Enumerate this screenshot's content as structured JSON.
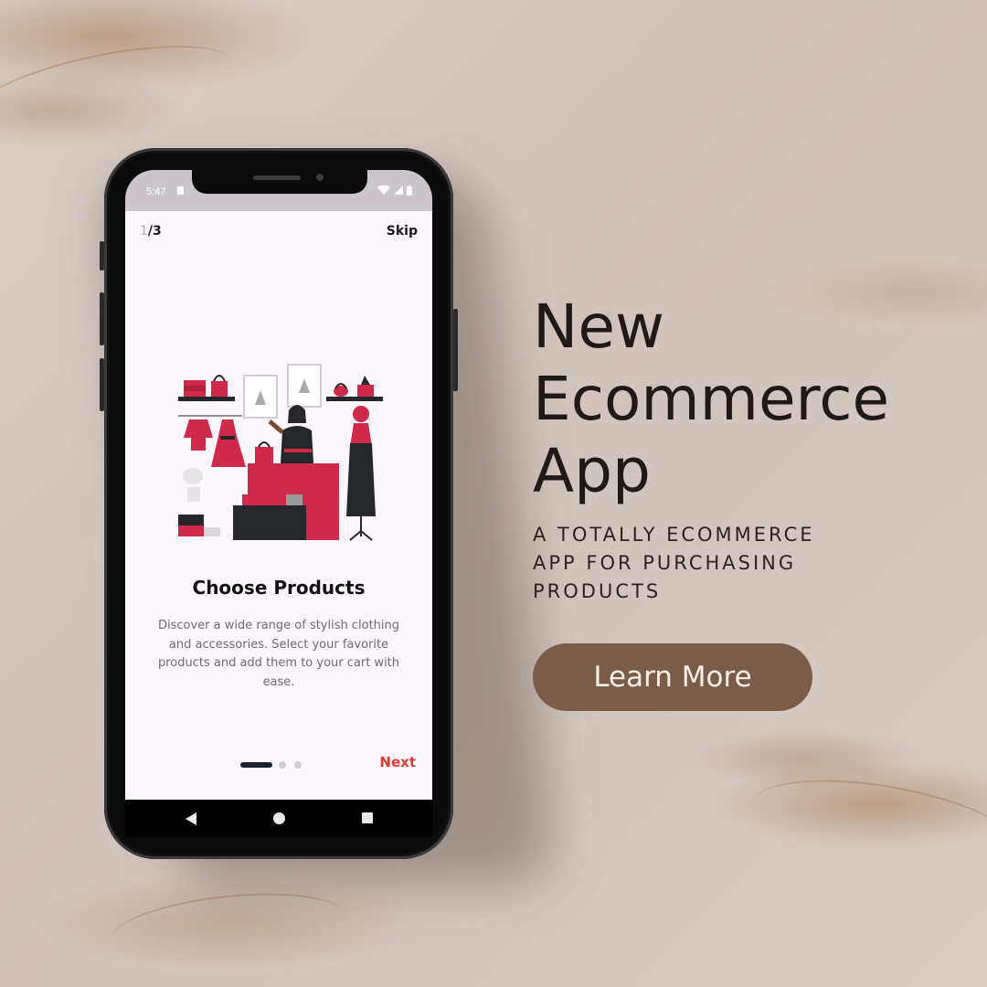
{
  "phone": {
    "status_bar": {
      "time": "5:47",
      "icons_right": [
        "wifi-icon",
        "signal-icon",
        "battery-icon"
      ]
    },
    "onboarding": {
      "page_current": "1",
      "page_total": "/3",
      "skip_label": "Skip",
      "title": "Choose Products",
      "description": "Discover a wide range of stylish clothing and accessories. Select your favorite products and add them to your cart with ease.",
      "next_label": "Next",
      "progress": {
        "current_step": 1,
        "total_steps": 3
      }
    },
    "nav_bar": {
      "icons": [
        "back-icon",
        "home-icon",
        "recents-icon"
      ]
    }
  },
  "promo": {
    "headline_lines": [
      "New",
      "Ecommerce",
      "App"
    ],
    "subheadline_lines": [
      "A TOTALLY ECOMMERCE",
      "APP FOR PURCHASING",
      "PRODUCTS"
    ],
    "cta_label": "Learn More"
  },
  "colors": {
    "accent_red": "#e23a33",
    "illustration_red": "#cf2a49",
    "dark_navy": "#1b2437",
    "cta_brown": "#7a5c48",
    "screen_bg": "#fcf7fd"
  }
}
